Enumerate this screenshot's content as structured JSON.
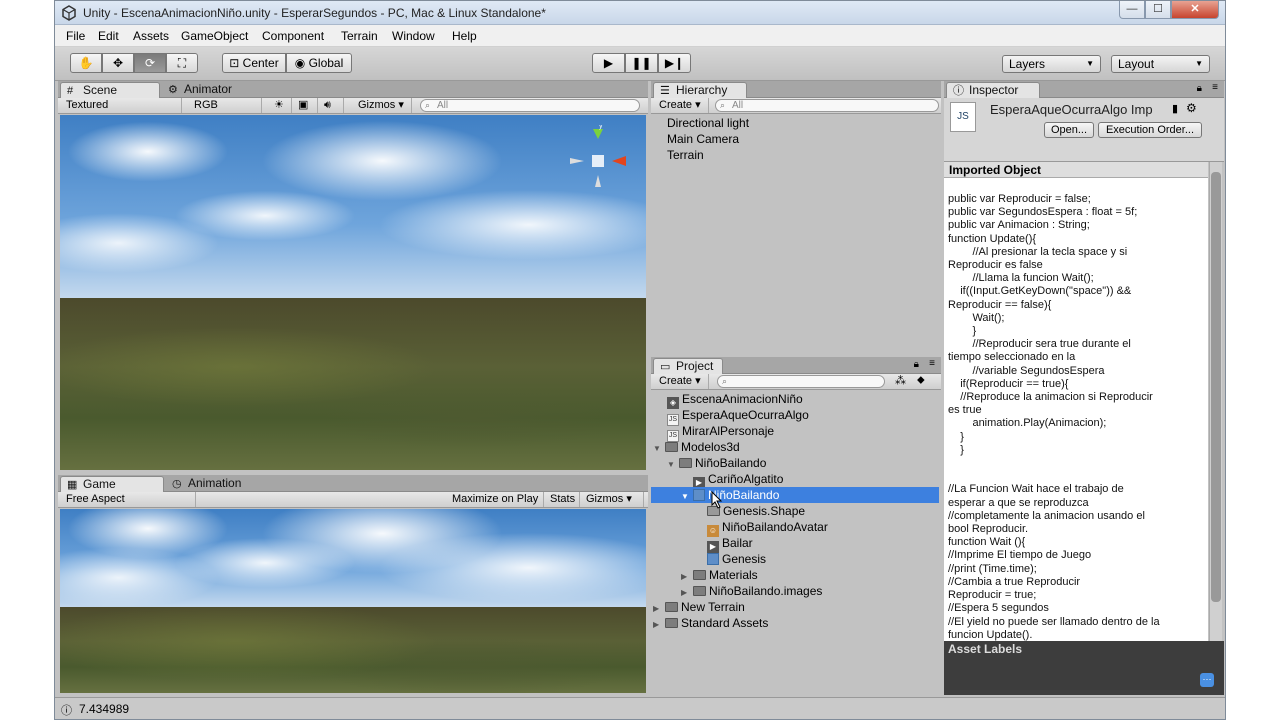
{
  "window": {
    "title": "Unity - EscenaAnimacionNiño.unity - EsperarSegundos - PC, Mac & Linux Standalone*",
    "min_label": "—",
    "max_label": "☐",
    "close_label": "✕"
  },
  "menu": [
    "File",
    "Edit",
    "Assets",
    "GameObject",
    "Component",
    "Terrain",
    "Window",
    "Help"
  ],
  "toolbar": {
    "pivot_label": "Center",
    "space_label": "Global",
    "layers_label": "Layers",
    "layout_label": "Layout"
  },
  "scene": {
    "tabs": [
      "Scene",
      "Animator"
    ],
    "render_mode": "Textured",
    "color_mode": "RGB",
    "gizmos_label": "Gizmos",
    "search_placeholder": "All",
    "gizmo_y": "y"
  },
  "game": {
    "tabs": [
      "Game",
      "Animation"
    ],
    "aspect": "Free Aspect",
    "maximize_label": "Maximize on Play",
    "stats_label": "Stats",
    "gizmos_label": "Gizmos"
  },
  "hierarchy": {
    "title": "Hierarchy",
    "create_label": "Create",
    "search_placeholder": "All",
    "items": [
      "Directional light",
      "Main Camera",
      "Terrain"
    ]
  },
  "project": {
    "title": "Project",
    "create_label": "Create",
    "items": [
      "EscenaAnimacionNiño",
      "EsperaAqueOcurraAlgo",
      "MirarAlPersonaje",
      "Modelos3d",
      "NiñoBailando",
      "CariñoAlgatito",
      "NiñoBailando",
      "Genesis.Shape",
      "NiñoBailandoAvatar",
      "Bailar",
      "Genesis",
      "Materials",
      "NiñoBailando.images",
      "New Terrain",
      "Standard Assets"
    ]
  },
  "inspector": {
    "title": "Inspector",
    "asset_name": "EsperaAqueOcurraAlgo Imp",
    "open_label": "Open...",
    "exec_label": "Execution Order...",
    "section_label": "Imported Object",
    "code": "public var Reproducir = false;\npublic var SegundosEspera : float = 5f;\npublic var Animacion : String;\nfunction Update(){\n        //Al presionar la tecla space y si\nReproducir es false\n        //Llama la funcion Wait();\n    if((Input.GetKeyDown(\"space\")) &&\nReproducir == false){\n        Wait();\n        }\n        //Reproducir sera true durante el\ntiempo seleccionado en la\n        //variable SegundosEspera\n    if(Reproducir == true){\n    //Reproduce la animacion si Reproducir\nes true\n        animation.Play(Animacion);\n    }\n    }\n\n\n//La Funcion Wait hace el trabajo de\nesperar a que se reproduzca\n//completamente la animacion usando el\nbool Reproducir.\nfunction Wait (){\n//Imprime El tiempo de Juego\n//print (Time.time);\n//Cambia a true Reproducir\nReproducir = true;\n//Espera 5 segundos\n//El yield no puede ser llamado dentro de la\nfuncion Update().",
    "labels_title": "Asset Labels",
    "js_badge": "JS"
  },
  "status": {
    "value": "7.434989"
  }
}
